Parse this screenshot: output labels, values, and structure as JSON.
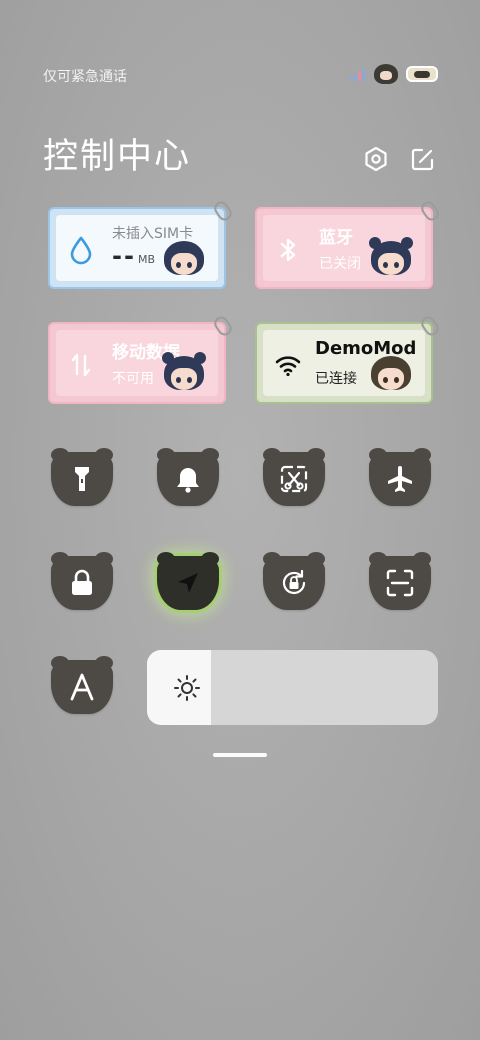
{
  "status_bar": {
    "text": "仅可紧急通话"
  },
  "header": {
    "title": "控制中心",
    "settings_icon": "hexagon-settings-icon",
    "edit_icon": "edit-icon"
  },
  "cards": {
    "sim": {
      "label": "未插入SIM卡",
      "value": "--",
      "unit": "MB",
      "icon": "water-drop-icon",
      "color": "#3a9be0"
    },
    "bluetooth": {
      "label": "蓝牙",
      "status": "已关闭",
      "icon": "bluetooth-icon"
    },
    "mobile_data": {
      "label": "移动数据",
      "status": "不可用",
      "icon": "data-arrows-icon"
    },
    "wifi": {
      "label": "DemoMod",
      "status": "已连接",
      "icon": "wifi-icon"
    }
  },
  "tiles": [
    {
      "name": "flashlight",
      "icon": "flashlight-icon",
      "active": false
    },
    {
      "name": "sound",
      "icon": "bell-icon",
      "active": false
    },
    {
      "name": "screenshot",
      "icon": "scissors-icon",
      "active": false
    },
    {
      "name": "airplane",
      "icon": "airplane-icon",
      "active": false
    },
    {
      "name": "lock",
      "icon": "lock-icon",
      "active": false
    },
    {
      "name": "location",
      "icon": "location-arrow-icon",
      "active": true
    },
    {
      "name": "rotation-lock",
      "icon": "rotation-lock-icon",
      "active": false
    },
    {
      "name": "scanner",
      "icon": "scan-icon",
      "active": false
    },
    {
      "name": "auto-brightness",
      "icon": "auto-brightness-icon",
      "active": false
    }
  ],
  "brightness": {
    "level": 0.22,
    "icon": "sun-icon"
  },
  "colors": {
    "accent_green": "#a6cf74",
    "tile_bg": "#4d4a46",
    "bluetooth_pink": "#f9d6de",
    "wifi_green": "#eef0e4"
  }
}
